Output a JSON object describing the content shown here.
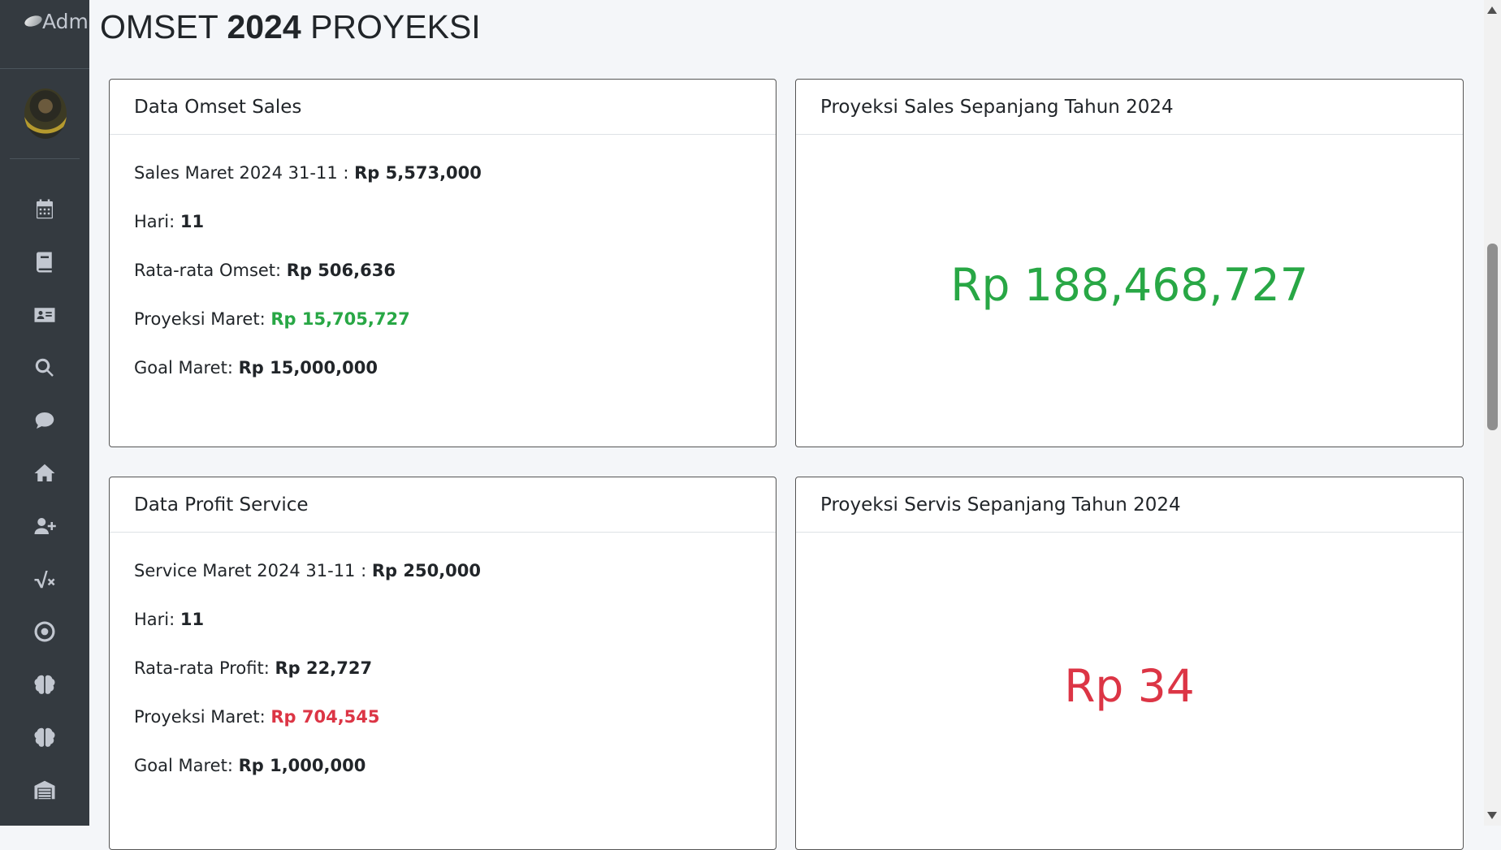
{
  "sidebar": {
    "brand": "Adm",
    "nav_icons": [
      "calendar-icon",
      "book-icon",
      "id-card-icon",
      "search-icon",
      "comment-icon",
      "home-icon",
      "user-plus-icon",
      "square-root-icon",
      "target-icon",
      "brain-icon",
      "brain-icon",
      "warehouse-icon",
      "table-icon"
    ]
  },
  "page_title": {
    "prefix": "OMSET",
    "year": "2024",
    "suffix": "PROYEKSI"
  },
  "sales_card": {
    "header": "Data Omset Sales",
    "rows": [
      {
        "label": "Sales Maret 2024 31-11 : ",
        "value": "Rp 5,573,000"
      },
      {
        "label": "Hari: ",
        "value": "11"
      },
      {
        "label": "Rata-rata Omset: ",
        "value": "Rp 506,636"
      },
      {
        "label": "Proyeksi Maret: ",
        "value": "Rp 15,705,727"
      },
      {
        "label": "Goal Maret: ",
        "value": "Rp 15,000,000"
      }
    ]
  },
  "sales_projection_card": {
    "header": "Proyeksi Sales Sepanjang Tahun 2024",
    "value": "Rp 188,468,727"
  },
  "service_card": {
    "header": "Data Profit Service",
    "rows": [
      {
        "label": "Service Maret 2024 31-11 : ",
        "value": "Rp 250,000"
      },
      {
        "label": "Hari: ",
        "value": "11"
      },
      {
        "label": "Rata-rata Profit: ",
        "value": "Rp 22,727"
      },
      {
        "label": "Proyeksi Maret: ",
        "value": "Rp 704,545"
      },
      {
        "label": "Goal Maret: ",
        "value": "Rp 1,000,000"
      }
    ]
  },
  "service_projection_card": {
    "header": "Proyeksi Servis Sepanjang Tahun 2024",
    "value": "Rp 34"
  },
  "colors": {
    "positive": "#28a745",
    "negative": "#dc3545",
    "sidebar_bg": "#343a40"
  }
}
